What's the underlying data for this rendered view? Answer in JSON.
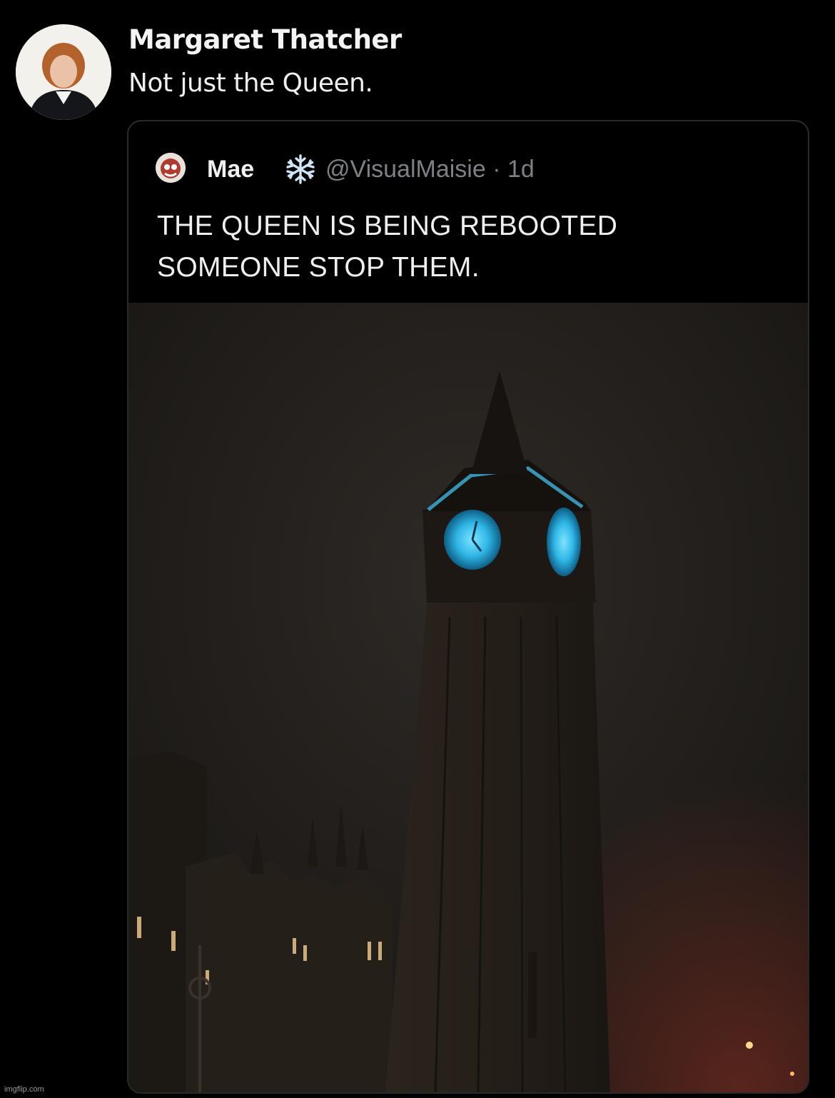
{
  "tweet": {
    "author_name": "Margaret Thatcher",
    "text": "Not just the Queen.",
    "avatar_icon": "portrait-avatar"
  },
  "quoted_tweet": {
    "author_name": "Mae",
    "name_emoji_icon": "snowflake-icon",
    "handle_time": "@VisualMaisie · 1d",
    "text_lines": [
      "THE QUEEN IS BEING REBOOTED",
      "SOMEONE STOP THEM."
    ],
    "media": "night-photo-big-ben-blue-clock-faces"
  },
  "watermark": "imgflip.com",
  "colors": {
    "background": "#000000",
    "handle_gray": "#7d8186",
    "clock_glow": "#2fb7e6"
  }
}
